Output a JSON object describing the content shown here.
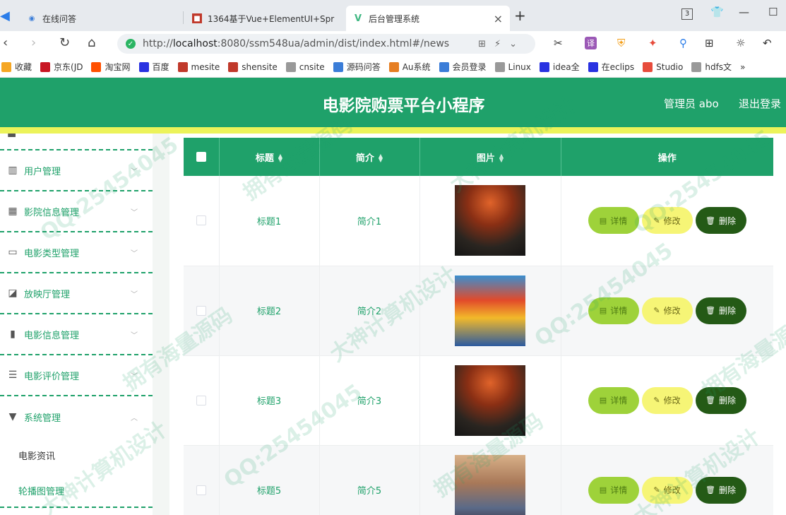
{
  "browser": {
    "tabs": [
      {
        "title": "在线问答"
      },
      {
        "title": "1364基于Vue+ElementUI+Spr"
      },
      {
        "title": "后台管理系统"
      }
    ],
    "tab_count": "3",
    "url_prefix": "http://",
    "url_host": "localhost",
    "url_rest": ":8080/ssm548ua/admin/dist/index.html#/news",
    "bookmarks": [
      {
        "label": "收藏",
        "icon": "star-icon",
        "color": "#f5a623"
      },
      {
        "label": "京东(JD",
        "icon": "jd-icon",
        "color": "#c81623"
      },
      {
        "label": "淘宝网",
        "icon": "taobao-icon",
        "color": "#ff5000"
      },
      {
        "label": "百度",
        "icon": "baidu-icon",
        "color": "#2932e1"
      },
      {
        "label": "mesite",
        "icon": "mesite-icon",
        "color": "#c0392b"
      },
      {
        "label": "shensite",
        "icon": "shensite-icon",
        "color": "#c0392b"
      },
      {
        "label": "cnsite",
        "icon": "page-icon",
        "color": "#999999"
      },
      {
        "label": "源码问答",
        "icon": "qa-icon",
        "color": "#3b7dd8"
      },
      {
        "label": "Au系统",
        "icon": "au-icon",
        "color": "#e67e22"
      },
      {
        "label": "会员登录",
        "icon": "member-icon",
        "color": "#3b7dd8"
      },
      {
        "label": "Linux",
        "icon": "page-icon",
        "color": "#999999"
      },
      {
        "label": "idea全",
        "icon": "baidu-icon",
        "color": "#2932e1"
      },
      {
        "label": "在eclips",
        "icon": "baidu-icon",
        "color": "#2932e1"
      },
      {
        "label": "Studio",
        "icon": "studio-icon",
        "color": "#e74c3c"
      },
      {
        "label": "hdfs文",
        "icon": "page-icon",
        "color": "#999999"
      }
    ],
    "more": "»"
  },
  "header": {
    "title": "电影院购票平台小程序",
    "admin": "管理员 abo",
    "logout": "退出登录",
    "bg_color": "#1fa16a",
    "strip_color": "#ecf35a"
  },
  "sidebar": {
    "items": [
      {
        "label": "用户管理",
        "icon": "user-icon"
      },
      {
        "label": "影院信息管理",
        "icon": "grid-icon"
      },
      {
        "label": "电影类型管理",
        "icon": "chat-icon"
      },
      {
        "label": "放映厅管理",
        "icon": "trend-icon"
      },
      {
        "label": "电影信息管理",
        "icon": "bar-chart-icon"
      },
      {
        "label": "电影评价管理",
        "icon": "sliders-icon"
      },
      {
        "label": "系统管理",
        "icon": "pin-icon"
      }
    ],
    "sub_items": [
      {
        "label": "电影资讯",
        "active": true
      },
      {
        "label": "轮播图管理",
        "active": false
      }
    ]
  },
  "table": {
    "headers": {
      "title": "标题",
      "intro": "简介",
      "image": "图片",
      "actions": "操作"
    },
    "rows": [
      {
        "title": "标题1",
        "intro": "简介1",
        "poster": "poster-a"
      },
      {
        "title": "标题2",
        "intro": "简介2",
        "poster": "poster-b"
      },
      {
        "title": "标题3",
        "intro": "简介3",
        "poster": "poster-a"
      },
      {
        "title": "标题5",
        "intro": "简介5",
        "poster": "poster-c"
      }
    ],
    "buttons": {
      "detail": "详情",
      "edit": "修改",
      "delete": "删除"
    }
  },
  "watermark": {
    "texts": [
      "QQ:25454045",
      "拥有海量源码",
      "大神计算机设计"
    ]
  }
}
